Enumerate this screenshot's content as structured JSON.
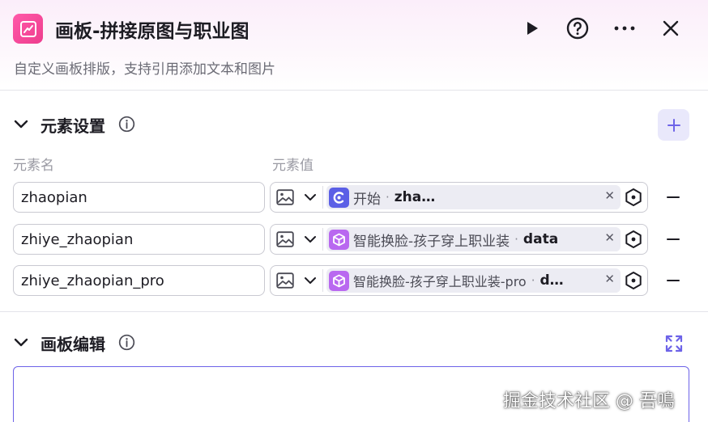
{
  "header": {
    "title": "画板-拼接原图与职业图",
    "subtitle": "自定义画板排版，支持引用添加文本和图片"
  },
  "elements_section": {
    "title": "元素设置",
    "col_name": "元素名",
    "col_value": "元素值",
    "rows": [
      {
        "name": "zhaopian",
        "type_icon": "image-icon",
        "source": "开始",
        "source_icon": "start-node-icon",
        "source_color": "#5b5fe6",
        "variable": "zhaopian"
      },
      {
        "name": "zhiye_zhaopian",
        "type_icon": "image-icon",
        "source": "智能换脸-孩子穿上职业装",
        "source_icon": "cube-icon",
        "source_color": "#b968f0",
        "variable": "data"
      },
      {
        "name": "zhiye_zhaopian_pro",
        "type_icon": "image-icon",
        "source": "智能换脸-孩子穿上职业装-pro",
        "source_icon": "cube-icon",
        "source_color": "#b968f0",
        "variable": "d…"
      }
    ]
  },
  "canvas_section": {
    "title": "画板编辑"
  },
  "watermark": "掘金技术社区 @ 吾鳴",
  "colors": {
    "accent": "#6d63e8",
    "brand_pink": "#ee3c8d"
  }
}
